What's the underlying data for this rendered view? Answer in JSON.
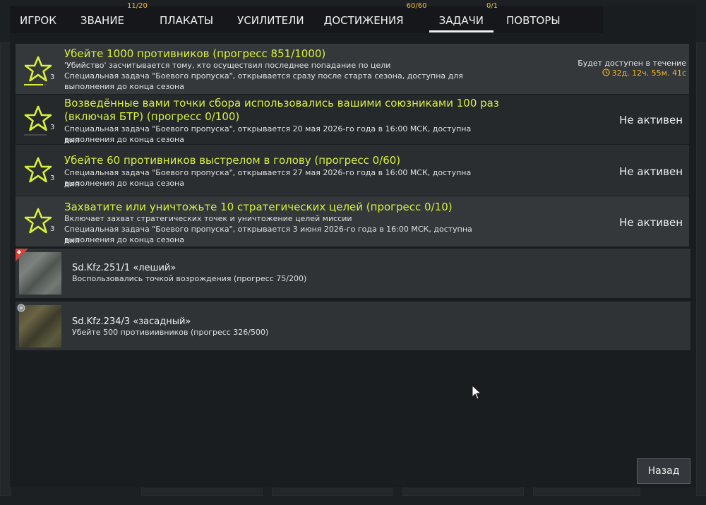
{
  "tabs": [
    {
      "label": "ИГРОК",
      "badge": ""
    },
    {
      "label": "ЗВАНИЕ",
      "badge": "11/20"
    },
    {
      "label": "ПЛАКАТЫ",
      "badge": ""
    },
    {
      "label": "УСИЛИТЕЛИ",
      "badge": ""
    },
    {
      "label": "ДОСТИЖЕНИЯ",
      "badge": "60/60"
    },
    {
      "label": "ЗАДАЧИ",
      "badge": "0/1",
      "active": true
    },
    {
      "label": "ПОВТОРЫ",
      "badge": ""
    }
  ],
  "tasks": [
    {
      "title": "Убейте 1000 противников (прогресс 851/1000)",
      "desc1": "'Убийство' засчитывается тому, кто осуществил последнее попадание по цели",
      "desc2": "Специальная задача \"Боевого пропуска\", открывается сразу после старта сезона, доступна для",
      "desc3": "выполнения до конца сезона",
      "level": "3",
      "progress": 0.851,
      "available_label": "Будет доступен в течение",
      "available_time": "32д. 12ч. 55м. 41с"
    },
    {
      "title1": "Возведённые вами точки сбора использовались вашими союзниками 100 раз",
      "title2": "(включая БТР) (прогресс 0/100)",
      "desc1": "Специальная задача \"Боевого пропуска\", открывается 20 мая 2026-го года в 16:00 МСК, доступна для",
      "desc2": "выполнения до конца сезона",
      "level": "3",
      "progress": 0,
      "status": "Не активен"
    },
    {
      "title": "Убейте 60 противников выстрелом в голову (прогресс 0/60)",
      "desc1": "Специальная задача \"Боевого пропуска\", открывается 27 мая 2026-го года в 16:00 МСК, доступна для",
      "desc2": "выполнения до конца сезона",
      "level": "3",
      "progress": 0,
      "status": "Не активен"
    },
    {
      "title": "Захватите или уничтожьте 10 стратегических целей (прогресс 0/10)",
      "desc1": "Включает захват стратегических точек и уничтожение целей миссии",
      "desc2": "Специальная задача \"Боевого пропуска\", открывается 3 июня 2026-го года в 16:00 МСК, доступна для",
      "desc3": "выполнения до конца сезона",
      "level": "3",
      "progress": 0,
      "status": "Не активен"
    }
  ],
  "units": [
    {
      "name": "Sd.Kfz.251/1 «леший»",
      "task": "Воспользовались точкой возрождения (прогресс 75/200)",
      "badge_color": "#d9413a"
    },
    {
      "name": "Sd.Kfz.234/3 «засадный»",
      "task": "Убейте 500 противиивников (прогресс 326/500)",
      "badge_color": "#8a8f93"
    }
  ],
  "back_label": "Назад",
  "colors": {
    "accent": "#d7f03c",
    "badge": "#f2c12e",
    "timer": "#f2b92e"
  }
}
